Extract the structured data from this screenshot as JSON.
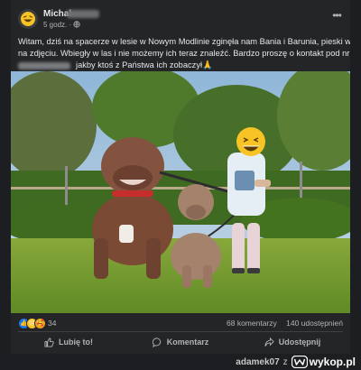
{
  "post": {
    "author_name": "Michał",
    "time": "5 godz. · ",
    "more_label": "•••",
    "text_line1": "Witam, dziś  na spacerze w lesie w Nowym Modlinie zginęła nam Bania i Barunia, pieski widoczne",
    "text_line2": "na zdjęciu. Wbiegły w las i nie możemy ich teraz znaleźć. Bardzo proszę o kontakt pod nr",
    "text_line3": "jakby ktoś z Państwa ich zobaczył🙏"
  },
  "reactions": {
    "icons": [
      "like-icon",
      "sad-icon",
      "care-icon"
    ],
    "count": "34",
    "comments": "68 komentarzy",
    "shares": "140 udostępnień"
  },
  "actions": {
    "like": "Lubię to!",
    "comment": "Komentarz",
    "share": "Udostępnij"
  },
  "footer": {
    "user": "adamek07",
    "connector": "z",
    "site": "wykop.pl"
  }
}
